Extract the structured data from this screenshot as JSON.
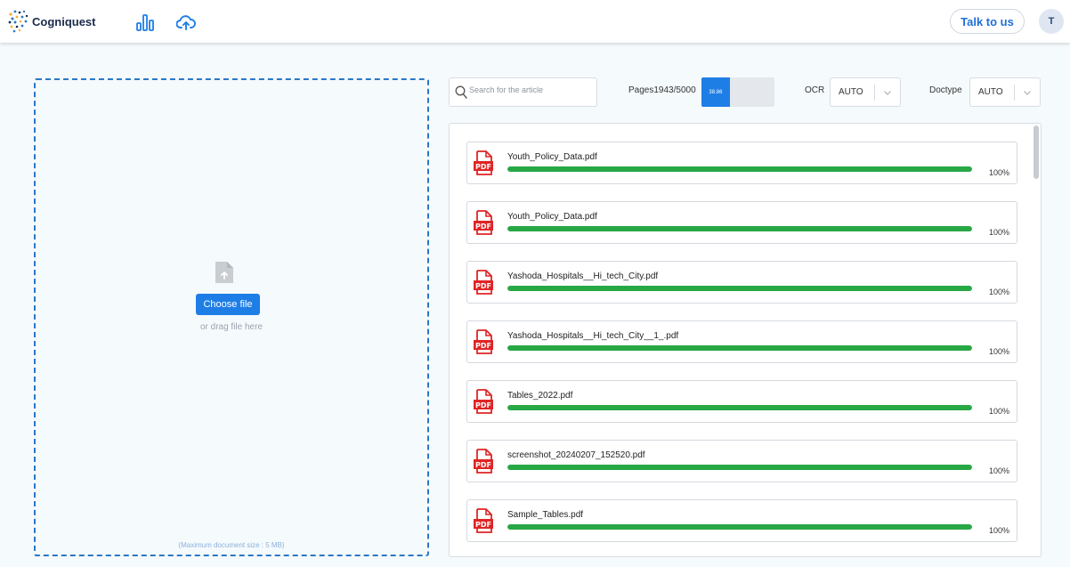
{
  "header": {
    "brand": "Cogniquest",
    "talk_label": "Talk to us",
    "avatar_initial": "T"
  },
  "upload": {
    "choose_label": "Choose file",
    "drag_text": "or drag file here",
    "max_size": "(Maximum document size : 5 MB)"
  },
  "toolbar": {
    "search_placeholder": "Search for the article",
    "pages_label": "Pages1943/5000",
    "pages_percent_label": "38.86",
    "pages_fraction": 0.3886,
    "ocr_label": "OCR",
    "ocr_value": "AUTO",
    "doctype_label": "Doctype",
    "doctype_value": "AUTO"
  },
  "files": [
    {
      "name": "Youth_Policy_Data.pdf",
      "progress_label": "100%",
      "progress": 1.0
    },
    {
      "name": "Youth_Policy_Data.pdf",
      "progress_label": "100%",
      "progress": 1.0
    },
    {
      "name": "Yashoda_Hospitals__Hi_tech_City.pdf",
      "progress_label": "100%",
      "progress": 1.0
    },
    {
      "name": "Yashoda_Hospitals__Hi_tech_City__1_.pdf",
      "progress_label": "100%",
      "progress": 1.0
    },
    {
      "name": "Tables_2022.pdf",
      "progress_label": "100%",
      "progress": 1.0
    },
    {
      "name": "screenshot_20240207_152520.pdf",
      "progress_label": "100%",
      "progress": 1.0
    },
    {
      "name": "Sample_Tables.pdf",
      "progress_label": "100%",
      "progress": 1.0
    }
  ],
  "icons": {
    "logo": "cogniquest-logo-icon",
    "chart": "bar-chart-icon",
    "cloud": "cloud-upload-icon",
    "search": "search-icon",
    "file": "file-upload-icon",
    "pdf": "pdf-file-icon",
    "chevron": "chevron-down-icon"
  },
  "colors": {
    "accent": "#1e7ee6",
    "progress": "#28a745",
    "pdf_red": "#e02424",
    "border_dashed": "#2a78c6"
  }
}
